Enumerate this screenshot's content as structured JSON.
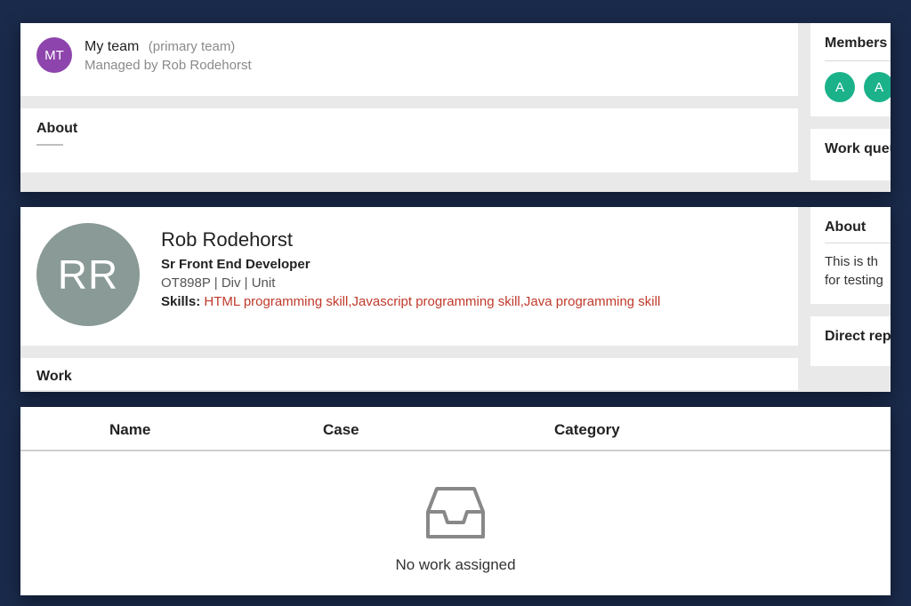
{
  "team": {
    "avatar_initials": "MT",
    "name": "My team",
    "subtitle": "(primary team)",
    "managed_by": "Managed by Rob Rodehorst",
    "about_heading": "About",
    "side": {
      "members_title": "Members",
      "member_badges": [
        "A",
        "A"
      ],
      "workqueue_title": "Work queue"
    }
  },
  "person": {
    "avatar_initials": "RR",
    "name": "Rob Rodehorst",
    "role": "Sr Front End Developer",
    "meta": "OT898P | Div | Unit",
    "skills_label": "Skills",
    "skills_sep": ": ",
    "skills_list": "HTML programming skill,Javascript programming skill,Java programming skill",
    "work_heading": "Work",
    "side": {
      "about_title": "About",
      "about_body1": "This is th",
      "about_body2": "for testing",
      "direct_title": "Direct reports"
    }
  },
  "work_table": {
    "columns": {
      "name": "Name",
      "case": "Case",
      "category": "Category"
    },
    "empty_message": "No work assigned"
  }
}
